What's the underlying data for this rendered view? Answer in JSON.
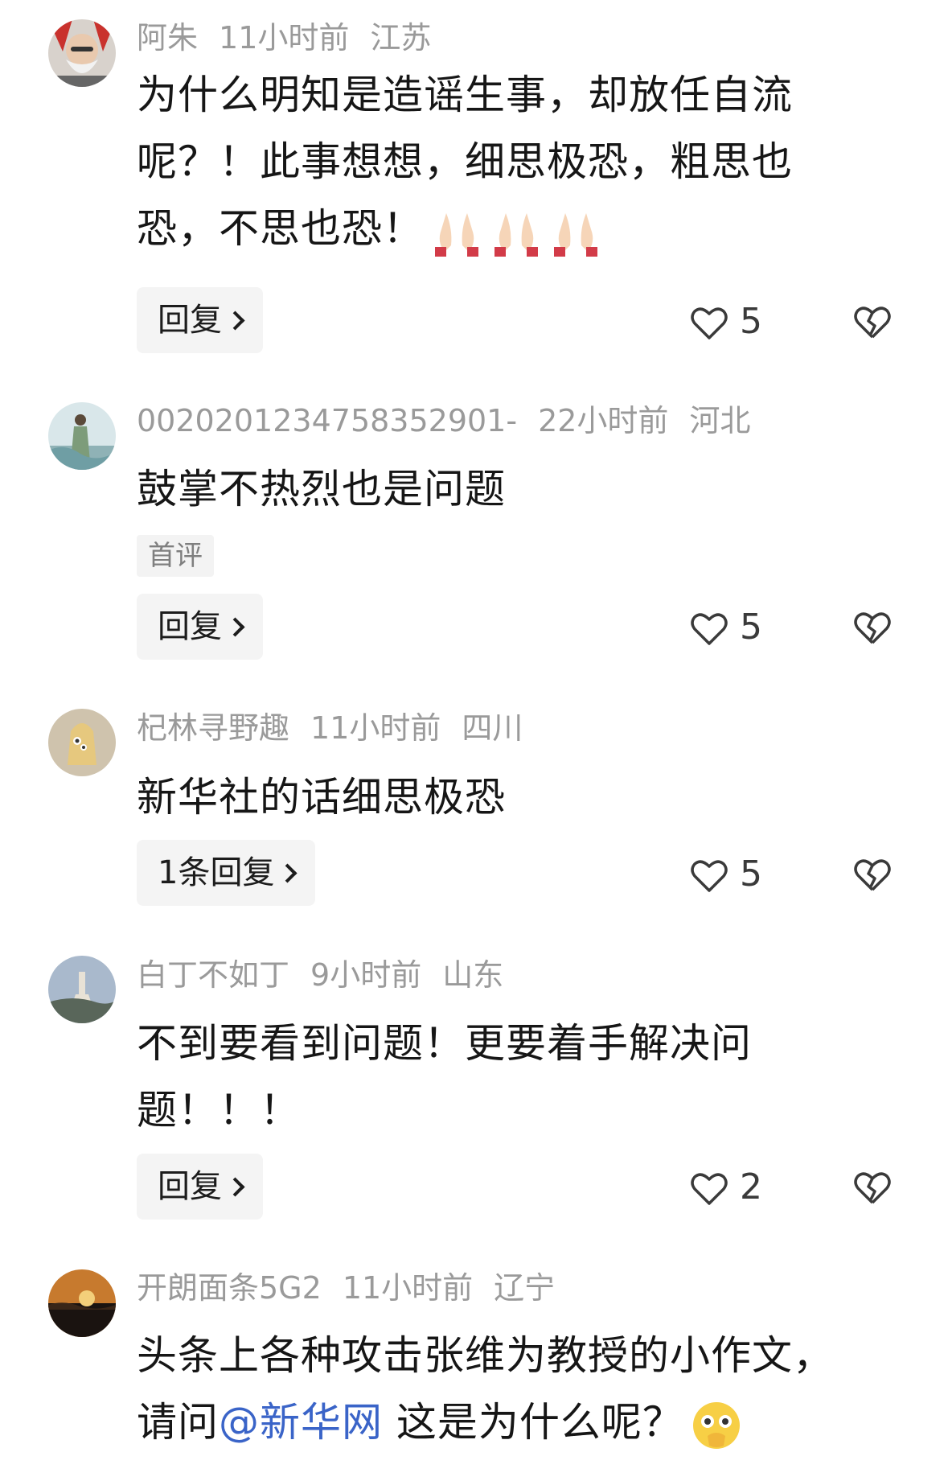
{
  "comments": [
    {
      "username": "阿朱",
      "time": "11小时前",
      "location": "江苏",
      "text": "为什么明知是造谣生事，却放任自流呢？！此事想想，细思极恐，粗思也恐，不思也恐！",
      "emoji_names": [
        "folded-hands-icon",
        "folded-hands-icon",
        "folded-hands-icon"
      ],
      "reply_label": "回复",
      "likes": "5"
    },
    {
      "username": "0020201234758352901-",
      "time": "22小时前",
      "location": "河北",
      "text": "鼓掌不热烈也是问题",
      "tag": "首评",
      "reply_label": "回复",
      "likes": "5"
    },
    {
      "username": "杞林寻野趣",
      "time": "11小时前",
      "location": "四川",
      "text": "新华社的话细思极恐",
      "reply_label": "1条回复",
      "likes": "5"
    },
    {
      "username": "白丁不如丁",
      "time": "9小时前",
      "location": "山东",
      "text": "不到要看到问题！更要着手解决问题！！！",
      "reply_label": "回复",
      "likes": "2"
    },
    {
      "username": "开朗面条5G2",
      "time": "11小时前",
      "location": "辽宁",
      "text_before": "头条上各种攻击张维为教授的小作文，请问",
      "mention": "@新华网",
      "text_after": " 这是为什么呢？",
      "emoji_name": "face-with-hand-over-mouth-icon"
    }
  ],
  "colors": {
    "meta": "#9a9a9a",
    "text": "#161616",
    "mention": "#3a64c8",
    "reply_bg": "#f4f4f4"
  }
}
